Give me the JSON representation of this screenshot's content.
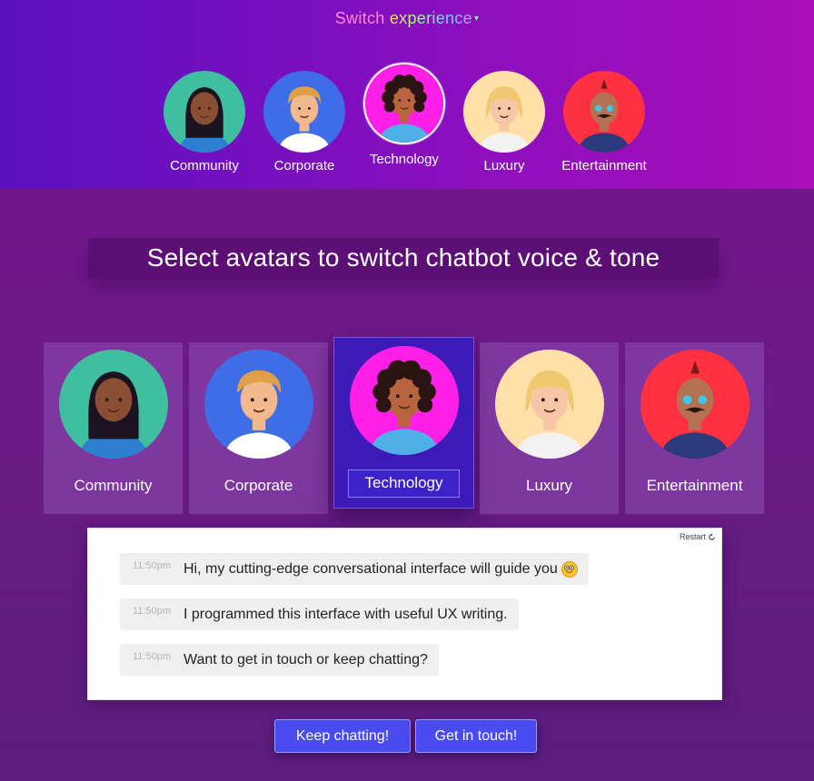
{
  "header": {
    "switch_word1": "Switch",
    "switch_word2": "experience",
    "caret": "▾"
  },
  "avatars": [
    {
      "id": "community",
      "label": "Community",
      "bg": "#3fbfa0",
      "skin": "#8a4e32",
      "hair": "#1b1420",
      "shirt": "#2f7fd0",
      "active": false
    },
    {
      "id": "corporate",
      "label": "Corporate",
      "bg": "#3f6de8",
      "skin": "#f2b98c",
      "hair": "#e0a04a",
      "shirt": "#ffffff",
      "active": false
    },
    {
      "id": "technology",
      "label": "Technology",
      "bg": "#ff1fe6",
      "skin": "#b8653f",
      "hair": "#2a1412",
      "shirt": "#4fb0e8",
      "active": true
    },
    {
      "id": "luxury",
      "label": "Luxury",
      "bg": "#ffe0a8",
      "skin": "#f7c6a6",
      "hair": "#f1c872",
      "shirt": "#f2f2f2",
      "active": false
    },
    {
      "id": "entertainment",
      "label": "Entertainment",
      "bg": "#ff3040",
      "skin": "#b47252",
      "hair": "#7a1a14",
      "shirt": "#2a3a7a",
      "active": false
    }
  ],
  "banner": {
    "text": "Select avatars to switch chatbot voice & tone"
  },
  "chat": {
    "restart_label": "Restart",
    "messages": [
      {
        "time": "11:50pm",
        "text": "Hi, my cutting-edge conversational interface will guide you"
      },
      {
        "time": "11:50pm",
        "text": "I programmed this interface with useful UX writing."
      },
      {
        "time": "11:50pm",
        "text": "Want to get in touch or keep chatting?"
      }
    ]
  },
  "buttons": {
    "keep_chatting": "Keep chatting!",
    "get_in_touch": "Get in touch!"
  }
}
